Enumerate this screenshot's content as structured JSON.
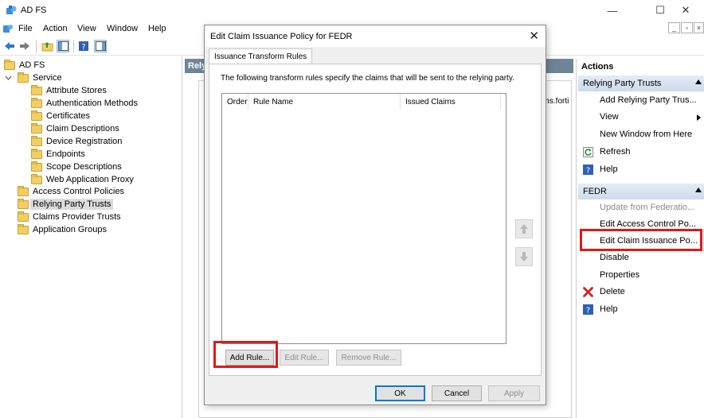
{
  "app": {
    "title": "AD FS"
  },
  "window_controls": {
    "minimize": "—",
    "maximize": "☐",
    "close": "✕"
  },
  "menu": [
    "File",
    "Action",
    "View",
    "Window",
    "Help"
  ],
  "mdi_controls": {
    "minimize": "_",
    "restore": "▫",
    "close": "×"
  },
  "tree": {
    "root": "AD FS",
    "service": "Service",
    "service_children": [
      "Attribute Stores",
      "Authentication Methods",
      "Certificates",
      "Claim Descriptions",
      "Device Registration",
      "Endpoints",
      "Scope Descriptions",
      "Web Application Proxy"
    ],
    "top_level": [
      "Access Control Policies",
      "Relying Party Trusts",
      "Claims Provider Trusts",
      "Application Groups"
    ],
    "selected": "Relying Party Trusts"
  },
  "middle": {
    "header": "Rely",
    "partial_text": "ems.forti"
  },
  "actions": {
    "title": "Actions",
    "section1": {
      "header": "Relying Party Trusts",
      "items": [
        "Add Relying Party Trus...",
        "View",
        "New Window from Here",
        "Refresh",
        "Help"
      ]
    },
    "section2": {
      "header": "FEDR",
      "items": [
        "Update from Federatio...",
        "Edit Access Control Po...",
        "Edit Claim Issuance Po...",
        "Disable",
        "Properties",
        "Delete",
        "Help"
      ]
    }
  },
  "dialog": {
    "title": "Edit Claim Issuance Policy for FEDR",
    "tab": "Issuance Transform Rules",
    "description": "The following transform rules specify the claims that will be sent to the relying party.",
    "columns": [
      "Order",
      "Rule Name",
      "Issued Claims"
    ],
    "rows": [],
    "buttons": {
      "add_rule": "Add Rule...",
      "edit_rule": "Edit Rule...",
      "remove_rule": "Remove Rule...",
      "ok": "OK",
      "cancel": "Cancel",
      "apply": "Apply"
    }
  },
  "colors": {
    "highlight": "#e01818",
    "pane_header": "#6f8597",
    "actions_header": "#cddbec"
  }
}
